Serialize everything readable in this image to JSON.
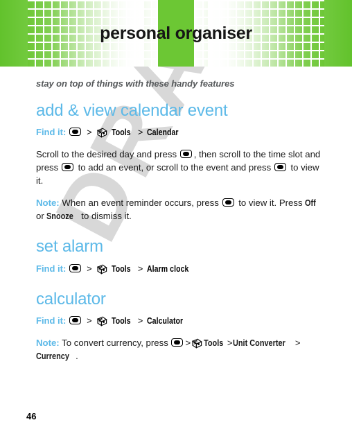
{
  "document": {
    "page_number": "46",
    "watermark": "DRAFT"
  },
  "header": {
    "title": "personal organiser",
    "band_color": "#6cc734"
  },
  "subtitle": "stay on top of things with these handy features",
  "accent_color": "#5cb9e8",
  "icons": {
    "center_key": "center-key-icon",
    "tools": "tools-icon"
  },
  "sections": [
    {
      "heading": "add & view calendar event",
      "findit": {
        "label": "Find it:",
        "sep1": ">",
        "tools": "Tools",
        "sep2": ">",
        "target": "Calendar"
      },
      "body": {
        "p1_a": "Scroll to the desired day and press ",
        "p1_b": ", then scroll to the time slot and press ",
        "p1_c": " to add an event, or scroll to the event and press ",
        "p1_d": " to view it."
      },
      "note": {
        "label": "Note:",
        "a": " When an event reminder occurs, press ",
        "b": " to view it. Press ",
        "off": "Off",
        "c": " or ",
        "snooze": "Snooze",
        "d": " to dismiss it."
      }
    },
    {
      "heading": "set alarm",
      "findit": {
        "label": "Find it:",
        "sep1": ">",
        "tools": "Tools",
        "sep2": ">",
        "target": "Alarm clock"
      }
    },
    {
      "heading": "calculator",
      "findit": {
        "label": "Find it:",
        "sep1": ">",
        "tools": "Tools",
        "sep2": ">",
        "target": "Calculator"
      },
      "note": {
        "label": "Note:",
        "a": " To convert currency, press ",
        "sep1": ">",
        "tools": "Tools",
        "sep2": ">",
        "unit": "Unit Converter",
        "sep3": ">",
        "currency": "Currency",
        "end": "."
      }
    }
  ]
}
